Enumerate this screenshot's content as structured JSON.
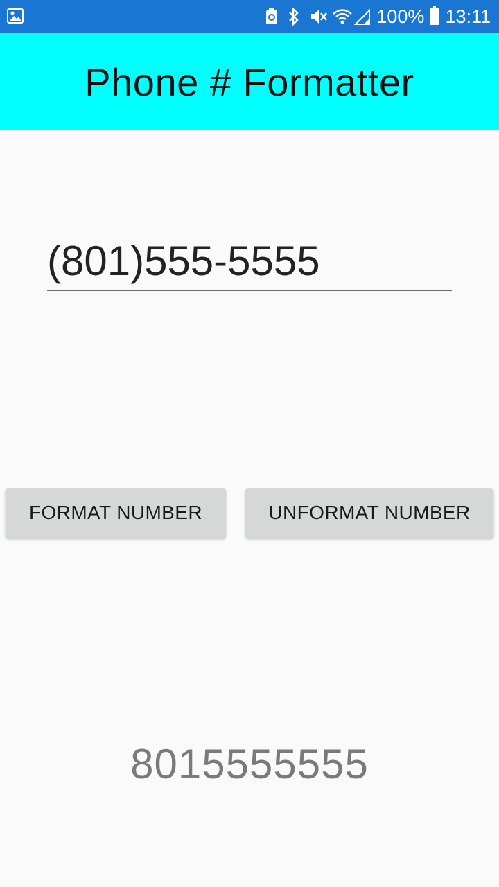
{
  "status_bar": {
    "battery": "100%",
    "time": "13:11",
    "icons": [
      "image-icon",
      "sync-icon",
      "bluetooth-icon",
      "mute-icon",
      "wifi-icon",
      "signal-icon",
      "battery-icon"
    ]
  },
  "app_bar": {
    "title": "Phone # Formatter",
    "color": "#00ffff"
  },
  "phone_input": {
    "value": "(801)555-5555"
  },
  "buttons": {
    "format_label": "FORMAT NUMBER",
    "unformat_label": "UNFORMAT NUMBER"
  },
  "result": {
    "text": "8015555555"
  },
  "colors": {
    "status_bar": "#1976d2",
    "button_bg": "#d6d7d7",
    "result_text": "#7a7a7a"
  }
}
